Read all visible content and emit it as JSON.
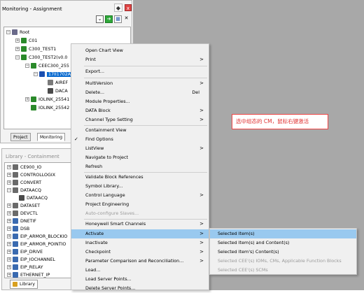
{
  "assignment": {
    "title": "Monitoring - Assignment",
    "close_glyph": "x",
    "pin_glyph": "◆",
    "tree": [
      {
        "label": "Root"
      },
      {
        "label": "C01"
      },
      {
        "label": "C300_TEST1"
      },
      {
        "label": "C300_TEST2(v0.0"
      },
      {
        "label": "CEEC300_255"
      },
      {
        "label": "17II1702A"
      },
      {
        "label": "AIREF"
      },
      {
        "label": "DACA"
      },
      {
        "label": "IOLINK_25541"
      },
      {
        "label": "IOLINK_25542"
      }
    ],
    "tabs": [
      "Project",
      "Monitoring"
    ]
  },
  "library": {
    "title": "Library - Containment",
    "tab": "Library",
    "items": [
      {
        "label": "CE900_IO"
      },
      {
        "label": "CONTROLLOGIX"
      },
      {
        "label": "CONVERT"
      },
      {
        "label": "DATAACQ"
      },
      {
        "label": "DATAACQ"
      },
      {
        "label": "DATASET"
      },
      {
        "label": "DEVCTL"
      },
      {
        "label": "DNETIF"
      },
      {
        "label": "DSB"
      },
      {
        "label": "EIP_ARMOR_BLOCKIO"
      },
      {
        "label": "EIP_ARMOR_POINTIO"
      },
      {
        "label": "EIP_DRIVE"
      },
      {
        "label": "EIP_IOCHANNEL"
      },
      {
        "label": "EIP_RELAY"
      },
      {
        "label": "ETHERNET_IP"
      }
    ]
  },
  "context_menu": {
    "items": [
      {
        "label": "Open Chart View"
      },
      {
        "label": "Print",
        "arrow": ">"
      },
      {
        "label": "Export..."
      },
      {
        "label": "MultiVersion",
        "arrow": ">"
      },
      {
        "label": "Delete...",
        "shortcut": "Del"
      },
      {
        "label": "Module Properties..."
      },
      {
        "label": "DATA Block",
        "arrow": ">"
      },
      {
        "label": "Channel Type Setting",
        "arrow": ">"
      },
      {
        "label": "Containment View"
      },
      {
        "label": "Find Options",
        "check": "✓"
      },
      {
        "label": "ListView",
        "arrow": ">"
      },
      {
        "label": "Navigate to Project"
      },
      {
        "label": "Refresh"
      },
      {
        "label": "Validate Block References"
      },
      {
        "label": "Symbol Library..."
      },
      {
        "label": "Control Language",
        "arrow": ">"
      },
      {
        "label": "Project Engineering"
      },
      {
        "label": "Auto-configure Slaves..."
      },
      {
        "label": "Honeywell Smart Channels",
        "arrow": ">"
      },
      {
        "label": "Activate",
        "arrow": ">"
      },
      {
        "label": "Inactivate",
        "arrow": ">"
      },
      {
        "label": "Checkpoint",
        "arrow": ">"
      },
      {
        "label": "Parameter Comparison and Reconciliation...",
        "arrow": ">"
      },
      {
        "label": "Load..."
      },
      {
        "label": "Load Server Points..."
      },
      {
        "label": "Delete Server Points..."
      }
    ]
  },
  "submenu": {
    "items": [
      {
        "label": "Selected Item(s)"
      },
      {
        "label": "Selected Item(s) and Content(s)"
      },
      {
        "label": "Selected Item's) Content(s)"
      },
      {
        "label": "Selected CEE'(s) IOMs, CMs, Applicable Function Blocks"
      },
      {
        "label": "Selected CEE'(s) SCMs"
      }
    ]
  },
  "annotation": {
    "text": "选中组态的 CM，鼠标右键激活",
    "color": "#e03030"
  },
  "colors": {
    "highlight": "#99c9ef",
    "workspace": "#a8a8a8",
    "selection": "#0a6bd0"
  }
}
